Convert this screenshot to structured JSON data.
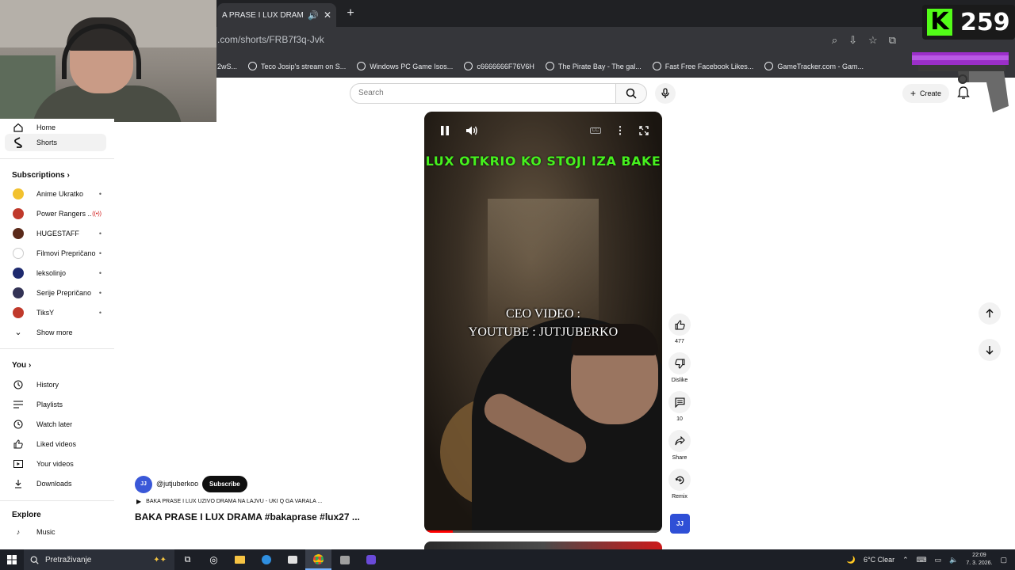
{
  "browser": {
    "tab_title": "A PRASE I LUX DRAMA #bak",
    "url": ".com/shorts/FRB7f3q-Jvk",
    "bookmarks": [
      {
        "label": "2wS..."
      },
      {
        "label": "Teco Josip's stream on S..."
      },
      {
        "label": "Windows PC Game Isos..."
      },
      {
        "label": "c6666666F76V6H"
      },
      {
        "label": "The Pirate Bay - The gal..."
      },
      {
        "label": "Fast Free Facebook Likes..."
      },
      {
        "label": "GameTracker.com - Gam..."
      }
    ]
  },
  "overlay": {
    "kick_count": "259"
  },
  "header": {
    "search_placeholder": "Search",
    "create_label": "Create"
  },
  "sidebar": {
    "home_label": "Home",
    "shorts_label": "Shorts",
    "subscriptions_title": "Subscriptions",
    "subscriptions": [
      {
        "name": "Anime Ukratko",
        "color": "#f2c12e"
      },
      {
        "name": "Power Rangers ...",
        "color": "#c0392b"
      },
      {
        "name": "HUGESTAFF",
        "color": "#5a2a1a"
      },
      {
        "name": "Filmovi Prepričano",
        "color": "#444444"
      },
      {
        "name": "leksolinjo",
        "color": "#1e2a6e"
      },
      {
        "name": "Serije Prepričano",
        "color": "#333355"
      },
      {
        "name": "TiksY",
        "color": "#c0392b"
      }
    ],
    "show_more_label": "Show more",
    "you_title": "You",
    "you_items": [
      {
        "label": "History"
      },
      {
        "label": "Playlists"
      },
      {
        "label": "Watch later"
      },
      {
        "label": "Liked videos"
      },
      {
        "label": "Your videos"
      },
      {
        "label": "Downloads"
      }
    ],
    "explore_title": "Explore",
    "explore_items": [
      {
        "label": "Music"
      }
    ]
  },
  "video": {
    "headline": "LUX OTKRIO KO STOJI IZA BAKE",
    "caption_line1": "CEO VIDEO :",
    "caption_line2": "YOUTUBE : JUTJUBERKO",
    "progress": 0.12,
    "cc_label": "CC"
  },
  "actions": {
    "likes": "477",
    "dislike_label": "Dislike",
    "comments": "10",
    "share_label": "Share",
    "remix_label": "Remix"
  },
  "channel": {
    "handle": "@jutjuberkoo",
    "subscribe_label": "Subscribe",
    "playlist_text": "BAKA PRASE I LUX UZIVO DRAMA NA LAJVU - UKI Q GA VARALA ...",
    "title": "BAKA PRASE I LUX DRAMA #bakaprase #lux27 ..."
  },
  "taskbar": {
    "search_text": "Pretraživanje",
    "weather": "6°C  Clear",
    "time": "22:09",
    "date": "7. 3. 2026."
  }
}
